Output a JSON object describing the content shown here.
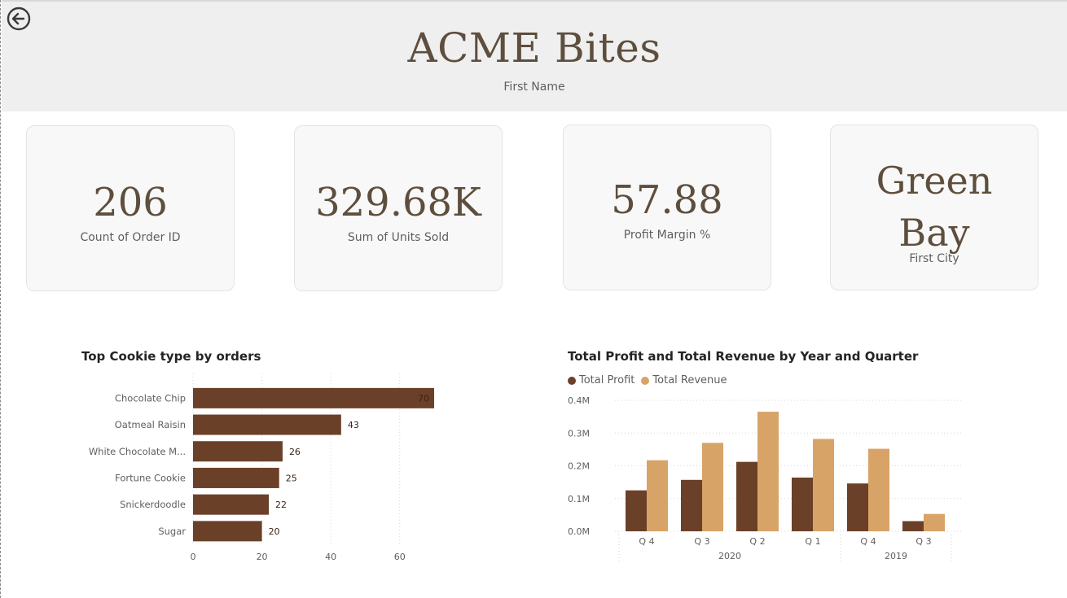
{
  "header": {
    "title": "ACME Bites",
    "subtitle": "First Name"
  },
  "kpis": [
    {
      "value": "206",
      "label": "Count of Order ID"
    },
    {
      "value": "329.68K",
      "label": "Sum of Units Sold"
    },
    {
      "value": "57.88",
      "label": "Profit Margin %"
    }
  ],
  "city_card": {
    "value_line1": "Green",
    "value_line2": "Bay",
    "label": "First City"
  },
  "colors": {
    "profit": "#6b4028",
    "revenue": "#d8a367",
    "text": "#5e4e3d"
  },
  "chart_data": [
    {
      "type": "bar",
      "orientation": "horizontal",
      "title": "Top Cookie type by orders",
      "categories": [
        "Chocolate Chip",
        "Oatmeal Raisin",
        "White Chocolate M...",
        "Fortune Cookie",
        "Snickerdoodle",
        "Sugar"
      ],
      "values": [
        70,
        43,
        26,
        25,
        22,
        20
      ],
      "xticks": [
        0,
        20,
        40,
        60
      ],
      "xlim": [
        0,
        70
      ],
      "grid": true
    },
    {
      "type": "bar",
      "title": "Total Profit and Total Revenue by Year and Quarter",
      "legend": "top-left",
      "categories": [
        "Q 4",
        "Q 3",
        "Q 2",
        "Q 1",
        "Q 4",
        "Q 3"
      ],
      "groups": [
        {
          "label": "2020",
          "count": 4
        },
        {
          "label": "2019",
          "count": 2
        }
      ],
      "series": [
        {
          "name": "Total Profit",
          "values": [
            0.125,
            0.157,
            0.212,
            0.164,
            0.146,
            0.031
          ]
        },
        {
          "name": "Total Revenue",
          "values": [
            0.217,
            0.27,
            0.365,
            0.282,
            0.252,
            0.053
          ]
        }
      ],
      "yticks": [
        "0.0M",
        "0.1M",
        "0.2M",
        "0.3M",
        "0.4M"
      ],
      "ylim": [
        0,
        0.4
      ],
      "ylabel_unit": "M",
      "grid": true
    }
  ]
}
